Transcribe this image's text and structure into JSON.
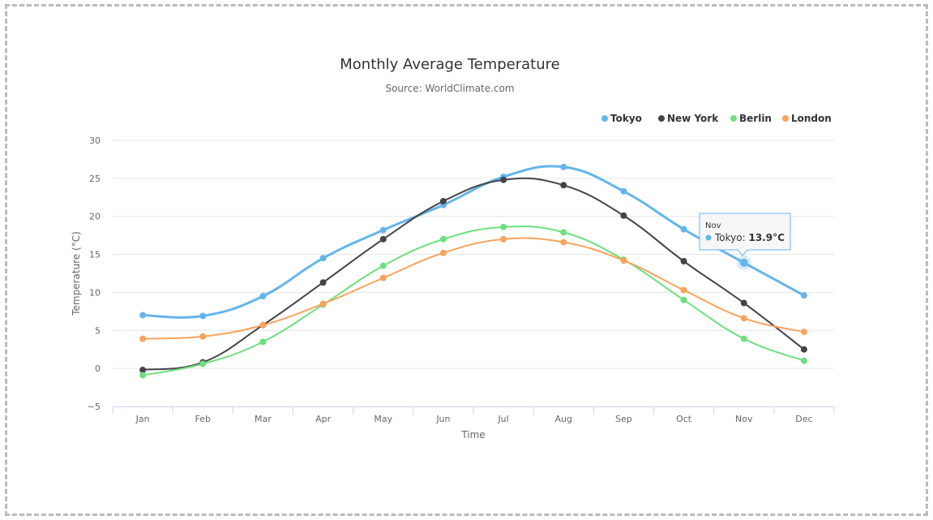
{
  "chart_data": {
    "type": "line",
    "title": "Monthly Average Temperature",
    "subtitle": "Source: WorldClimate.com",
    "xlabel": "Time",
    "ylabel": "Temperature (°C)",
    "categories": [
      "Jan",
      "Feb",
      "Mar",
      "Apr",
      "May",
      "Jun",
      "Jul",
      "Aug",
      "Sep",
      "Oct",
      "Nov",
      "Dec"
    ],
    "ylim": [
      -5,
      30
    ],
    "yticks": [
      -5,
      0,
      5,
      10,
      15,
      20,
      25,
      30
    ],
    "grid": true,
    "legend_placement": "top-right",
    "series": [
      {
        "name": "Tokyo",
        "color": "#64b5ec",
        "values": [
          7.0,
          6.9,
          9.5,
          14.5,
          18.2,
          21.5,
          25.2,
          26.5,
          23.3,
          18.3,
          13.9,
          9.6
        ]
      },
      {
        "name": "New York",
        "color": "#434348",
        "values": [
          -0.2,
          0.8,
          5.7,
          11.3,
          17.0,
          22.0,
          24.8,
          24.1,
          20.1,
          14.1,
          8.6,
          2.5
        ]
      },
      {
        "name": "Berlin",
        "color": "#6de07f",
        "values": [
          -0.9,
          0.6,
          3.5,
          8.4,
          13.5,
          17.0,
          18.6,
          17.9,
          14.3,
          9.0,
          3.9,
          1.0
        ]
      },
      {
        "name": "London",
        "color": "#f7a35c",
        "values": [
          3.9,
          4.2,
          5.7,
          8.5,
          11.9,
          15.2,
          17.0,
          16.6,
          14.2,
          10.3,
          6.6,
          4.8
        ]
      }
    ],
    "tooltip": {
      "header": "Nov",
      "series": "Tokyo",
      "value": "13.9°C"
    }
  }
}
